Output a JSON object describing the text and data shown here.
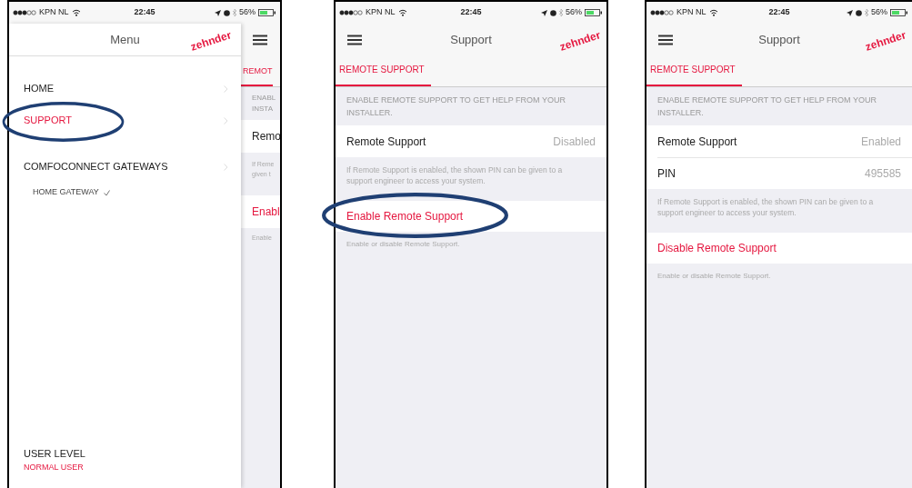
{
  "phones": [
    {
      "kind": "menu",
      "status": {
        "carrier": "KPN NL",
        "time": "22:45",
        "battery": "56%"
      },
      "menu": {
        "title": "Menu",
        "logo": "zehnder",
        "items": [
          {
            "label": "HOME",
            "selected": false,
            "highlighted": false
          },
          {
            "label": "SUPPORT",
            "selected": true,
            "highlighted": true
          },
          {
            "label": "COMFOCONNECT GATEWAYS",
            "selected": false,
            "highlighted": false,
            "children": [
              {
                "label": "HOME GATEWAY",
                "checked": true
              }
            ]
          }
        ],
        "user_level": {
          "label": "USER LEVEL",
          "value": "NORMAL USER"
        }
      },
      "peek": {
        "tab": "REMOT",
        "header": [
          "ENABL",
          "INSTA"
        ],
        "row": "Remo",
        "note": [
          "If Reme",
          "given t"
        ],
        "action": "Enabl",
        "action_note": "Enable"
      }
    },
    {
      "kind": "support",
      "status": {
        "carrier": "KPN NL",
        "time": "22:45",
        "battery": "56%"
      },
      "title": "Support",
      "logo": "zehnder",
      "tabs": [
        {
          "label": "REMOTE SUPPORT",
          "selected": true
        }
      ],
      "header": "ENABLE REMOTE SUPPORT TO GET HELP FROM YOUR INSTALLER.",
      "rows": [
        {
          "label": "Remote Support",
          "value": "Disabled"
        }
      ],
      "note": "If Remote Support is enabled, the shown PIN can be given to a support engineer to access your system.",
      "action": {
        "label": "Enable Remote Support",
        "highlighted": true
      },
      "action_note": "Enable or disable Remote Support."
    },
    {
      "kind": "support",
      "status": {
        "carrier": "KPN NL",
        "time": "22:45",
        "battery": "56%"
      },
      "title": "Support",
      "logo": "zehnder",
      "tabs": [
        {
          "label": "REMOTE SUPPORT",
          "selected": true
        }
      ],
      "header": "ENABLE REMOTE SUPPORT TO GET HELP FROM YOUR INSTALLER.",
      "rows": [
        {
          "label": "Remote Support",
          "value": "Enabled"
        },
        {
          "label": "PIN",
          "value": "495585"
        }
      ],
      "note": "If Remote Support is enabled, the shown PIN can be given to a support engineer to access your system.",
      "action": {
        "label": "Disable Remote Support",
        "highlighted": false
      },
      "action_note": "Enable or disable Remote Support."
    }
  ]
}
